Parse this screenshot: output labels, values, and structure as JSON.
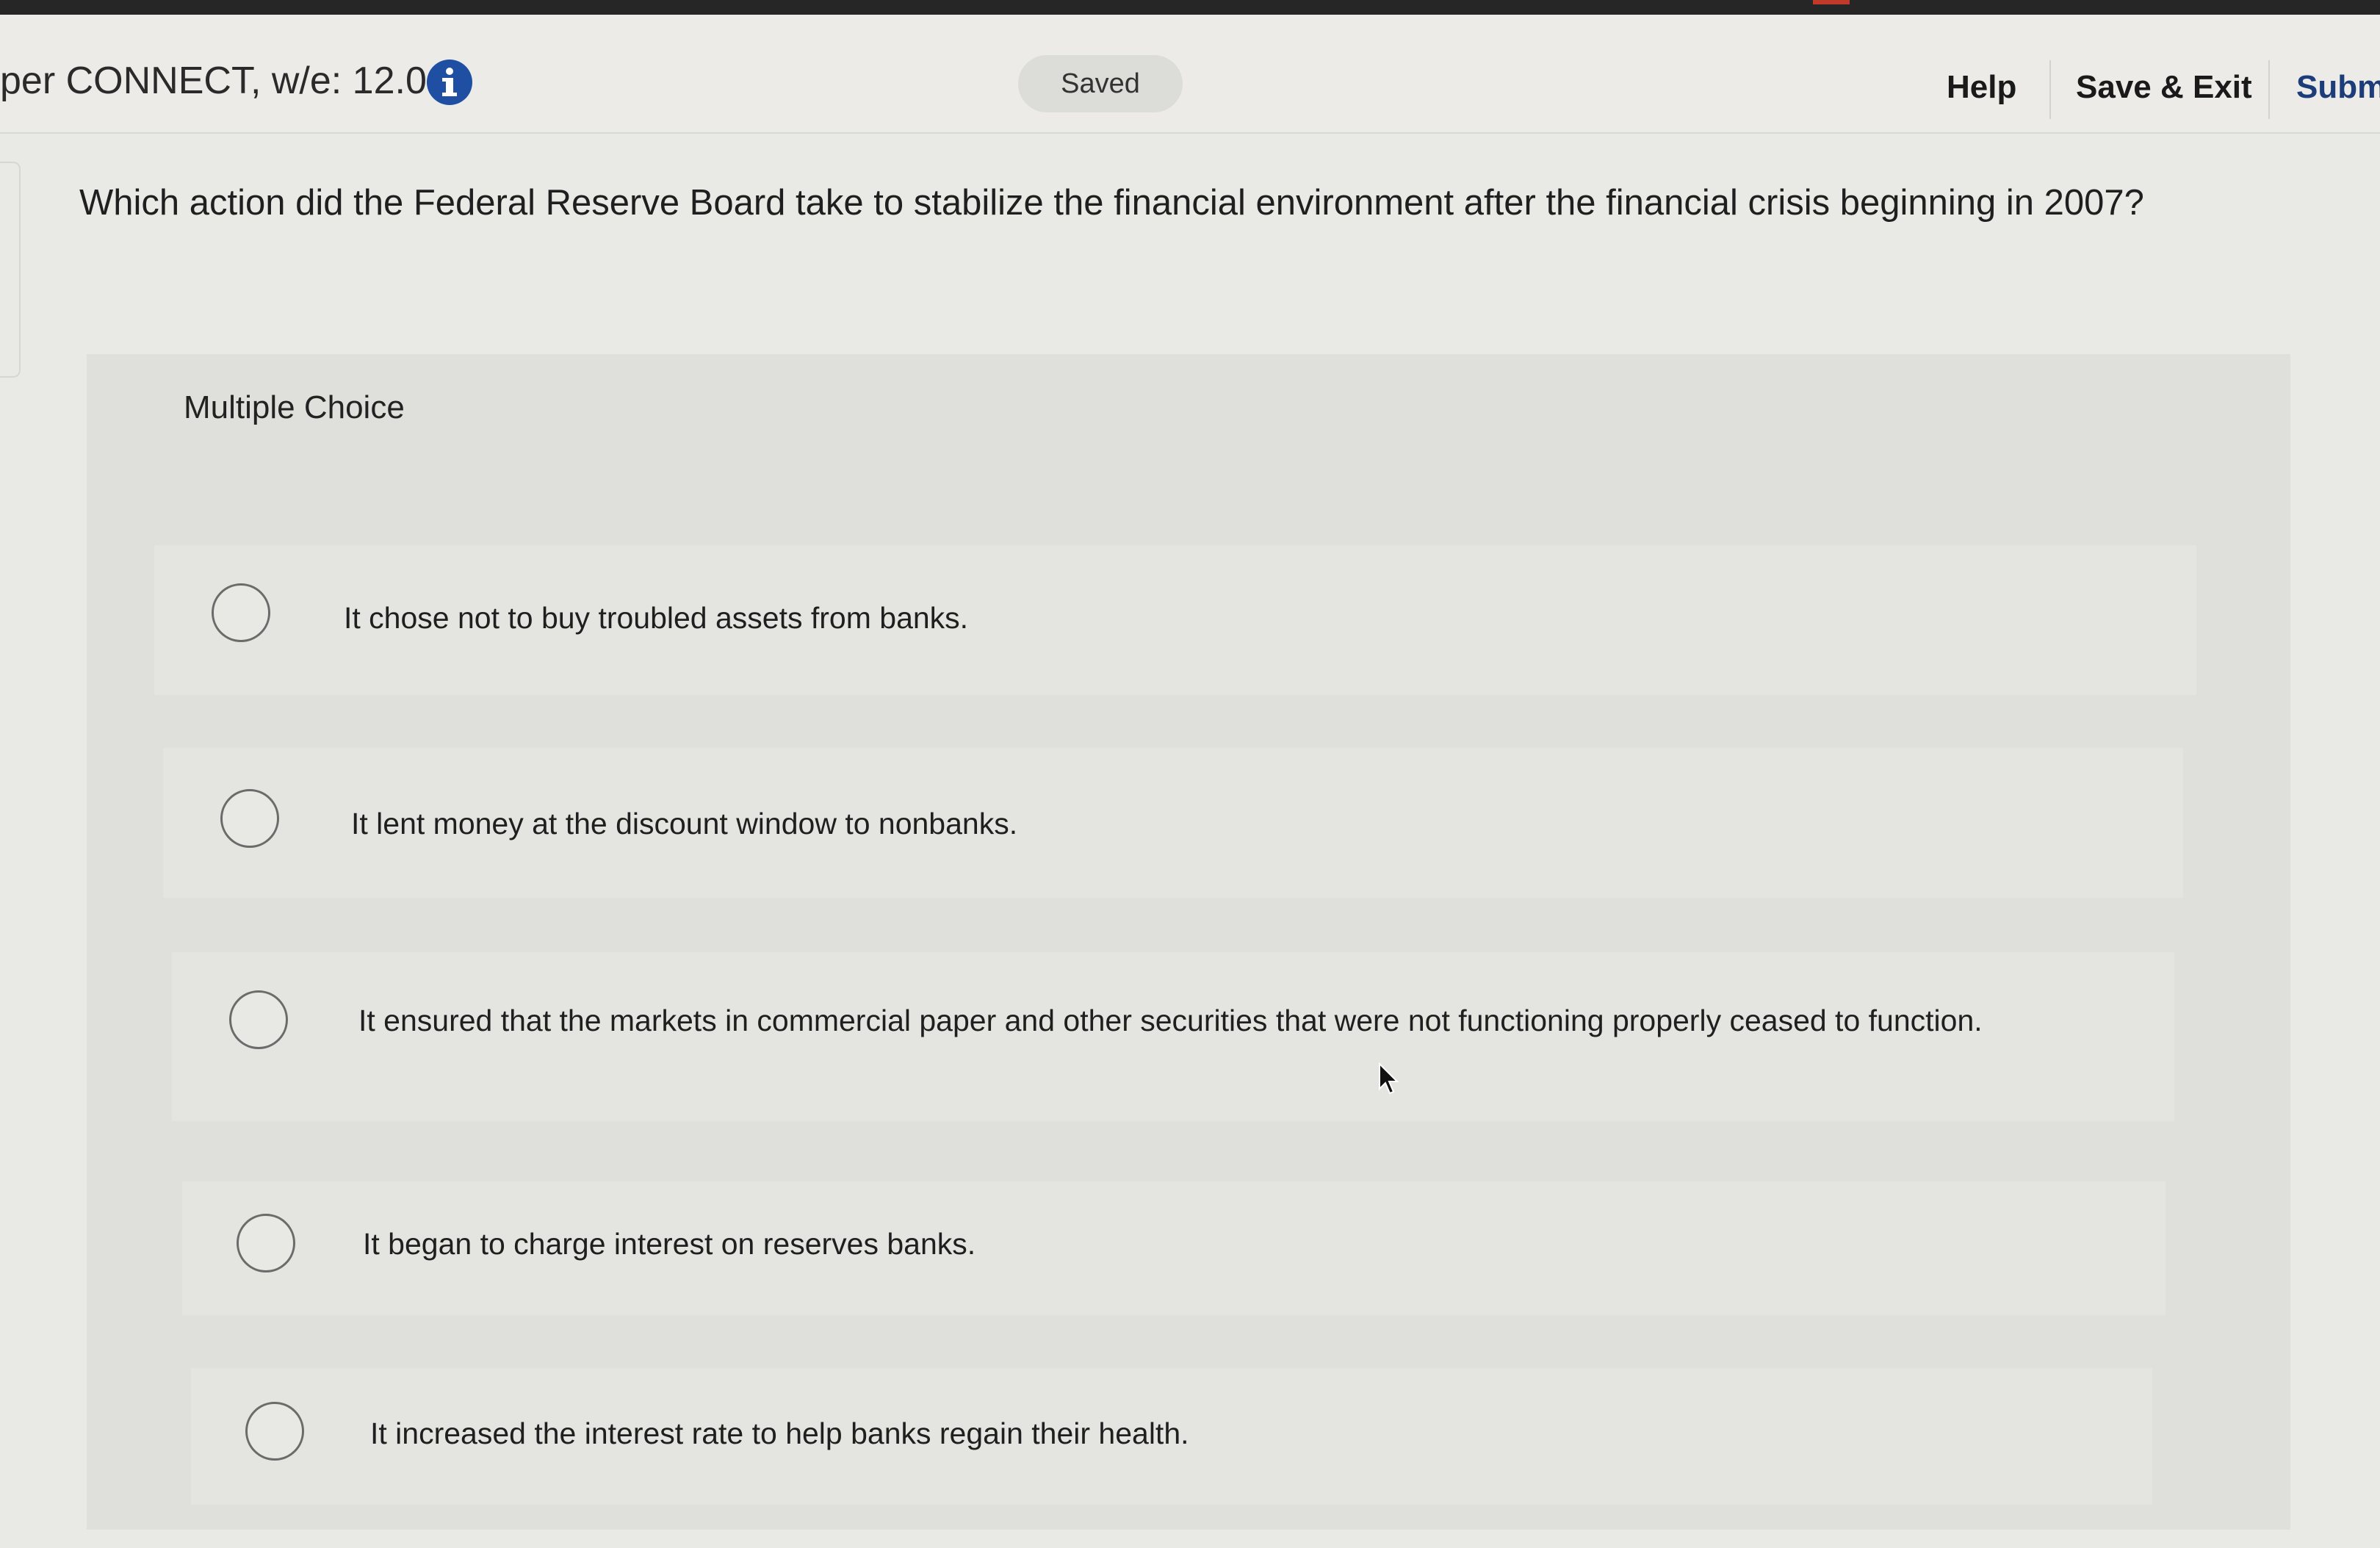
{
  "header": {
    "assignment_title": "per CONNECT, w/e: 12.01",
    "saved_status": "Saved",
    "help_label": "Help",
    "save_exit_label": "Save & Exit",
    "submit_label": "Subm"
  },
  "question": {
    "text": "Which action did the Federal Reserve Board take to stabilize the financial environment after the financial crisis beginning in 2007?",
    "type_label": "Multiple Choice",
    "options": [
      {
        "text": "It chose not to buy troubled assets from banks."
      },
      {
        "text": "It lent money at the discount window to nonbanks."
      },
      {
        "text": "It ensured that the markets in commercial paper and other securities that were not functioning properly ceased to function."
      },
      {
        "text": "It began to charge interest on reserves banks."
      },
      {
        "text": "It increased the interest rate to help banks regain their health."
      }
    ]
  },
  "icons": {
    "info": "info-icon",
    "cursor": "mouse-pointer-icon"
  },
  "colors": {
    "info_icon": "#1f4fa3",
    "submit_link": "#1c3d7a"
  }
}
